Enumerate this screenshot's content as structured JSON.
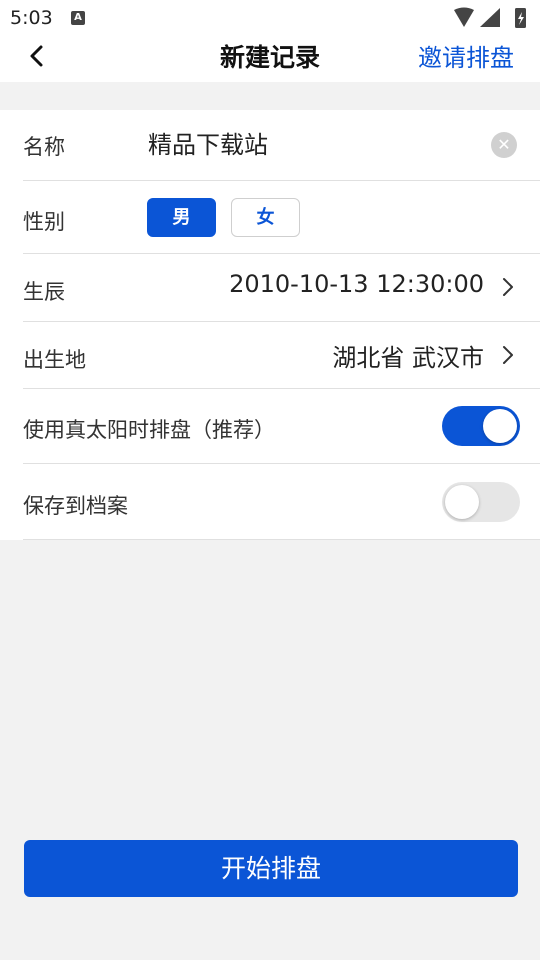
{
  "status_bar": {
    "time": "5:03",
    "notification_icon_letter": "A",
    "icons": [
      "wifi-icon",
      "signal-icon",
      "battery-icon"
    ]
  },
  "nav": {
    "title": "新建记录",
    "action": "邀请排盘",
    "back_icon": "chevron-left-icon"
  },
  "form": {
    "name": {
      "label": "名称",
      "value": "精品下载站",
      "clear_icon": "clear-icon"
    },
    "gender": {
      "label": "性别",
      "options": [
        "男",
        "女"
      ],
      "selected": "男"
    },
    "birth": {
      "label": "生辰",
      "value": "2010-10-13 12:30:00"
    },
    "birthplace": {
      "label": "出生地",
      "value": "湖北省 武汉市"
    },
    "true_solar": {
      "label": "使用真太阳时排盘（推荐）",
      "on": true
    },
    "save_archive": {
      "label": "保存到档案",
      "on": false
    }
  },
  "primary_button": "开始排盘",
  "colors": {
    "accent": "#0b55d6",
    "background": "#f2f2f2",
    "surface": "#ffffff",
    "divider": "#e0e0e0",
    "toggle_off": "#e6e6e6"
  }
}
